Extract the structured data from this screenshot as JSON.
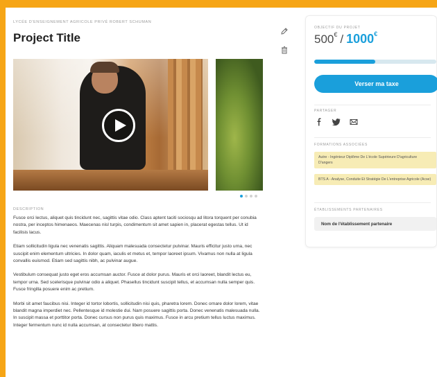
{
  "project": {
    "school": "LYCÉE D'ENSEIGNEMENT AGRICOLE PRIVÉ ROBERT SCHUMAN",
    "title": "Project Title",
    "actions": {
      "edit_icon": "pencil-icon",
      "delete_icon": "trash-icon"
    }
  },
  "carousel": {
    "play_icon": "play-icon",
    "slides": 4,
    "active_slide": 1
  },
  "description": {
    "label": "DESCRIPTION",
    "paragraphs": [
      "Fusce orci lectus, aliquet quis tincidunt nec, sagittis vitae odio. Class aptent taciti sociosqu ad litora torquent per conubia nostra, per inceptos himenaeos. Maecenas nisl turpis, condimentum sit amet sapien in, placerat egestas tellus. Ut id facilisis lacus.",
      "Etiam sollicitudin ligula nec venenatis sagittis. Aliquam malesuada consectetur pulvinar. Mauris efficitur justo urna, nec suscipit enim elementum ultricies. In dolor quam, iaculis et metus et, tempor laoreet ipsum. Vivamus non nulla at ligula convallis euismod. Etiam sed sagittis nibh, ac pulvinar augue.",
      "Vestibulum consequat justo eget eros accumsan auctor. Fusce at dolor purus. Mauris et orci laoreet, blandit lectus eu, tempor urna. Sed scelerisque pulvinar odio a aliquet. Phasellus tincidunt suscipit tellus, et accumsan nulla semper quis. Fusce fringilla posuere enim ac pretium.",
      "Morbi sit amet faucibus nisi. Integer id tortor lobortis, sollicitudin nisi quis, pharetra lorem. Donec ornare dolor lorem, vitae blandit magna imperdiet nec. Pellentesque id molestie dui. Nam posuere sagittis porta. Donec venenatis malesuada nulla. In suscipit massa et porttitor porta. Donec cursus non purus quis maximus. Fusce in arcu pretium tellus luctus maximus. Integer fermentum nunc id nulla accumsan, at consectetur libero mattis."
    ]
  },
  "funding": {
    "label": "OBJECTIF DU PROJET",
    "current": "500",
    "goal": "1000",
    "currency": "€",
    "separator": "/",
    "progress_fraction": 0.5,
    "cta": "Verser ma taxe"
  },
  "share": {
    "label": "PARTAGER",
    "icons": [
      "facebook-icon",
      "twitter-icon",
      "mail-icon"
    ]
  },
  "formations": {
    "label": "FORMATIONS ASSOCIÉES",
    "items": [
      "Autre - Ingénieur Diplôme De L'école Supérieure D'agriculture D'angers",
      "BTS A - Analyse, Conduite Et Stratégie De L'entreprise Agricole (Acse)"
    ]
  },
  "partners": {
    "label": "ÉTABLISSEMENTS PARTENAIRES",
    "items": [
      "Nom de l'établissement partenaire"
    ]
  },
  "colors": {
    "accent": "#1a9fdb",
    "frame": "#f6a516",
    "highlight": "#f7ecb5"
  }
}
